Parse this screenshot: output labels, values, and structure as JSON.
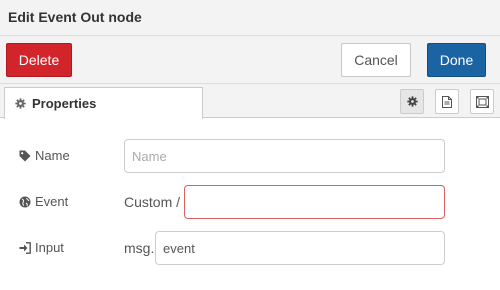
{
  "tray": {
    "title": "Edit Event Out node"
  },
  "toolbar": {
    "delete_label": "Delete",
    "cancel_label": "Cancel",
    "done_label": "Done"
  },
  "tabs": {
    "properties_label": "Properties",
    "icons": [
      "gear-icon",
      "description-icon",
      "appearance-icon"
    ]
  },
  "form": {
    "name": {
      "label": "Name",
      "icon": "tag-icon",
      "value": "",
      "placeholder": "Name"
    },
    "event": {
      "label": "Event",
      "icon": "globe-icon",
      "prefix": "Custom /",
      "value": "",
      "invalid": true
    },
    "input": {
      "label": "Input",
      "icon": "sign-in-icon",
      "prefix": "msg.",
      "value": "event"
    }
  },
  "colors": {
    "delete": "#d1252b",
    "done": "#1a64a3",
    "invalid_border": "#d6615f",
    "header_bg": "#f3f3f3"
  }
}
